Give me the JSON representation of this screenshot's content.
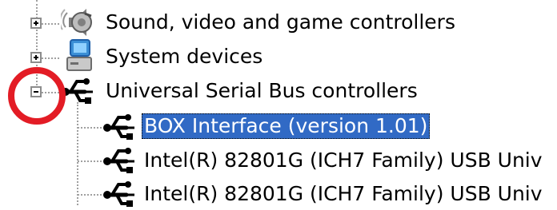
{
  "tree": {
    "nodes": [
      {
        "label": "Sound, video and game controllers",
        "icon": "speaker-icon",
        "expander": "plus"
      },
      {
        "label": "System devices",
        "icon": "computer-icon",
        "expander": "plus"
      },
      {
        "label": "Universal Serial Bus controllers",
        "icon": "usb-icon",
        "expander": "minus"
      }
    ],
    "children": [
      {
        "label": "BOX Interface (version 1.01)",
        "icon": "usb-icon",
        "selected": true
      },
      {
        "label": "Intel(R) 82801G (ICH7 Family) USB Univ",
        "icon": "usb-icon"
      },
      {
        "label": "Intel(R) 82801G (ICH7 Family) USB Univ",
        "icon": "usb-icon"
      }
    ]
  },
  "colors": {
    "selection": "#316ac5",
    "callout": "#e31c25"
  }
}
